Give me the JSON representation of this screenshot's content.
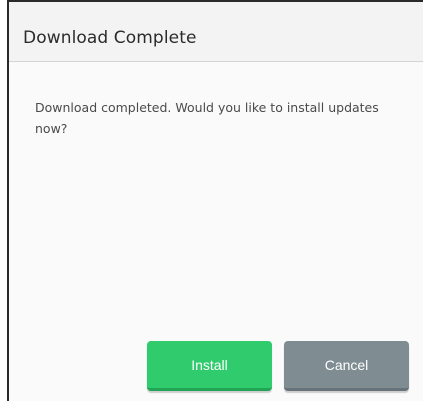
{
  "dialog": {
    "title": "Download Complete",
    "message": "Download completed. Would you like to install updates now?",
    "buttons": {
      "install_label": "Install",
      "cancel_label": "Cancel"
    }
  },
  "colors": {
    "install": "#2fcb6c",
    "cancel": "#7f8c92"
  }
}
